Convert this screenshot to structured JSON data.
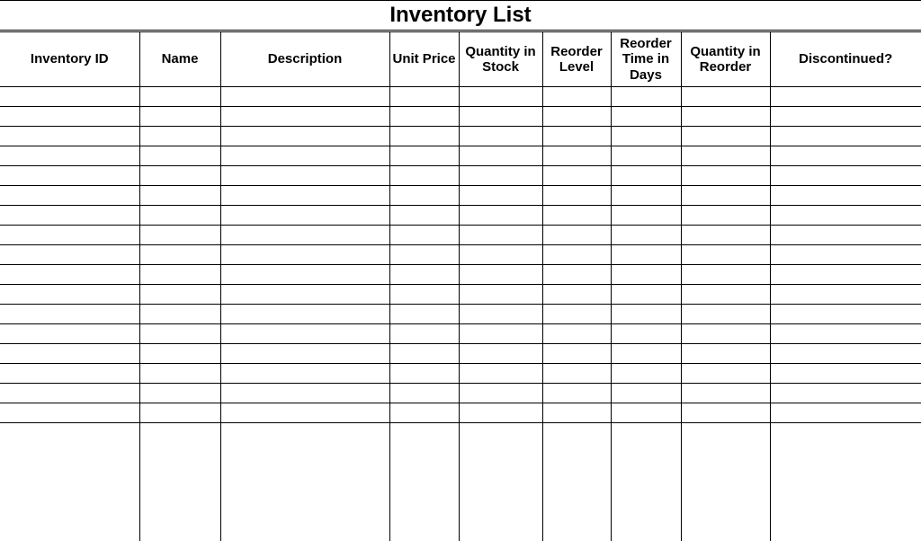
{
  "title": "Inventory List",
  "columns": [
    "Inventory ID",
    "Name",
    "Description",
    "Unit Price",
    "Quantity in Stock",
    "Reorder Level",
    "Reorder Time in Days",
    "Quantity in Reorder",
    "Discontinued?"
  ],
  "rows": [
    [
      "",
      "",
      "",
      "",
      "",
      "",
      "",
      "",
      ""
    ],
    [
      "",
      "",
      "",
      "",
      "",
      "",
      "",
      "",
      ""
    ],
    [
      "",
      "",
      "",
      "",
      "",
      "",
      "",
      "",
      ""
    ],
    [
      "",
      "",
      "",
      "",
      "",
      "",
      "",
      "",
      ""
    ],
    [
      "",
      "",
      "",
      "",
      "",
      "",
      "",
      "",
      ""
    ],
    [
      "",
      "",
      "",
      "",
      "",
      "",
      "",
      "",
      ""
    ],
    [
      "",
      "",
      "",
      "",
      "",
      "",
      "",
      "",
      ""
    ],
    [
      "",
      "",
      "",
      "",
      "",
      "",
      "",
      "",
      ""
    ],
    [
      "",
      "",
      "",
      "",
      "",
      "",
      "",
      "",
      ""
    ],
    [
      "",
      "",
      "",
      "",
      "",
      "",
      "",
      "",
      ""
    ],
    [
      "",
      "",
      "",
      "",
      "",
      "",
      "",
      "",
      ""
    ],
    [
      "",
      "",
      "",
      "",
      "",
      "",
      "",
      "",
      ""
    ],
    [
      "",
      "",
      "",
      "",
      "",
      "",
      "",
      "",
      ""
    ],
    [
      "",
      "",
      "",
      "",
      "",
      "",
      "",
      "",
      ""
    ],
    [
      "",
      "",
      "",
      "",
      "",
      "",
      "",
      "",
      ""
    ],
    [
      "",
      "",
      "",
      "",
      "",
      "",
      "",
      "",
      ""
    ],
    [
      "",
      "",
      "",
      "",
      "",
      "",
      "",
      "",
      ""
    ]
  ],
  "blank_rows": 6
}
